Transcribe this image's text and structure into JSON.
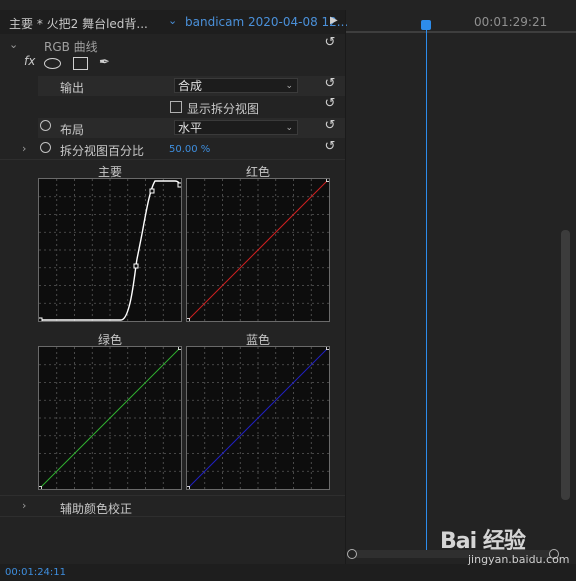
{
  "header": {
    "source_tab": "主要 * 火把2 舞台led背...",
    "clip_tab": "bandicam 2020-04-08 12...",
    "timeline_timecode": "00:01:29:21"
  },
  "effect": {
    "name": "RGB 曲线",
    "fx_label": "fx",
    "output_label": "输出",
    "output_value": "合成",
    "split_view_label": "显示拆分视图",
    "layout_label": "布局",
    "layout_value": "水平",
    "split_percent_label": "拆分视图百分比",
    "split_percent_value": "50.00 %",
    "secondary_label": "辅助颜色校正"
  },
  "curves": [
    {
      "title": "主要",
      "color": "#ffffff"
    },
    {
      "title": "红色",
      "color": "#d02020"
    },
    {
      "title": "绿色",
      "color": "#30b030"
    },
    {
      "title": "蓝色",
      "color": "#2020c0"
    }
  ],
  "footer": {
    "timecode": "00:01:24:11"
  },
  "watermark": {
    "brand": "Bai 经验",
    "url": "jingyan.baidu.com"
  }
}
